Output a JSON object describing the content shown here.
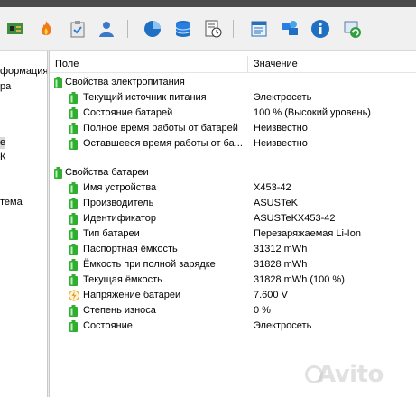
{
  "toolbar": {
    "icons": [
      "motherboard-icon",
      "flame-icon",
      "clipboard-check-icon",
      "user-icon",
      "pie-chart-icon",
      "database-icon",
      "report-clock-icon",
      "report-icon",
      "network-globe-icon",
      "info-icon",
      "refresh-icon"
    ]
  },
  "sidebar": {
    "items": [
      "формация",
      "ра",
      "е",
      "К",
      "тема"
    ]
  },
  "header": {
    "col_field": "Поле",
    "col_value": "Значение"
  },
  "sections": [
    {
      "title": "Свойства электропитания",
      "rows": [
        {
          "name": "Текущий источник питания",
          "value": "Электросеть",
          "icon": "battery-icon"
        },
        {
          "name": "Состояние батарей",
          "value": "100 % (Высокий уровень)",
          "icon": "battery-icon"
        },
        {
          "name": "Полное время работы от батарей",
          "value": "Неизвестно",
          "icon": "battery-icon"
        },
        {
          "name": "Оставшееся время работы от ба...",
          "value": "Неизвестно",
          "icon": "battery-icon"
        }
      ]
    },
    {
      "title": "Свойства батареи",
      "rows": [
        {
          "name": "Имя устройства",
          "value": "X453-42",
          "icon": "battery-icon"
        },
        {
          "name": "Производитель",
          "value": "ASUSTeK",
          "icon": "battery-icon"
        },
        {
          "name": "Идентификатор",
          "value": "ASUSTeKX453-42",
          "icon": "battery-icon"
        },
        {
          "name": "Тип батареи",
          "value": "Перезаряжаемая Li-Ion",
          "icon": "battery-icon"
        },
        {
          "name": "Паспортная ёмкость",
          "value": "31312 mWh",
          "icon": "battery-icon"
        },
        {
          "name": "Ёмкость при полной зарядке",
          "value": "31828 mWh",
          "icon": "battery-icon"
        },
        {
          "name": "Текущая ёмкость",
          "value": "31828 mWh  (100 %)",
          "icon": "battery-icon"
        },
        {
          "name": "Напряжение батареи",
          "value": "7.600 V",
          "icon": "lightning-icon"
        },
        {
          "name": "Степень износа",
          "value": "0 %",
          "icon": "battery-icon"
        },
        {
          "name": "Состояние",
          "value": "Электросеть",
          "icon": "battery-icon"
        }
      ]
    }
  ],
  "watermark": {
    "text": "Avito"
  },
  "colors": {
    "battery": "#2fae2f",
    "lightning": "#e8a020"
  }
}
